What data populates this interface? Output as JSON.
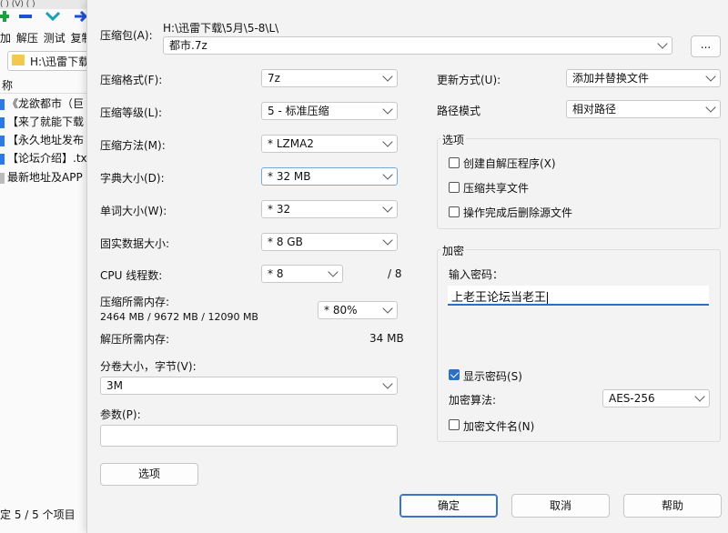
{
  "background_window": {
    "title_fragment": "( )  (V)  ( )",
    "toolbar_labels": [
      "加",
      "解压",
      "测试",
      "复制"
    ],
    "address": "H:\\迅雷下载",
    "column_header": "称",
    "files": [
      "《龙欲都市（巨",
      "【来了就能下载",
      "【永久地址发布",
      "【论坛介绍】.txt",
      "最新地址及APP"
    ],
    "status": "定 5 / 5 个项目"
  },
  "dialog": {
    "archive_label": "压缩包(A):",
    "archive_path": "H:\\迅雷下载\\5月\\5-8\\L\\",
    "archive_name": "都市.7z",
    "browse_label": "...",
    "format_label": "压缩格式(F):",
    "format_value": "7z",
    "level_label": "压缩等级(L):",
    "level_value": "5 - 标准压缩",
    "method_label": "压缩方法(M):",
    "method_value": "* LZMA2",
    "dict_label": "字典大小(D):",
    "dict_value": "* 32 MB",
    "word_label": "单词大小(W):",
    "word_value": "* 32",
    "solid_label": "固实数据大小:",
    "solid_value": "* 8 GB",
    "threads_label": "CPU 线程数:",
    "threads_value": "* 8",
    "threads_max": "/ 8",
    "mem_compress_label": "压缩所需内存:",
    "mem_compress_detail": "2464 MB / 9672 MB / 12090 MB",
    "mem_percent_value": "* 80%",
    "mem_decompress_label": "解压所需内存:",
    "mem_decompress_value": "34 MB",
    "volume_label": "分卷大小，字节(V):",
    "volume_value": "3M",
    "params_label": "参数(P):",
    "params_value": "",
    "options_button": "选项",
    "update_label": "更新方式(U):",
    "update_value": "添加并替换文件",
    "pathmode_label": "路径模式",
    "pathmode_value": "相对路径",
    "options_group_title": "选项",
    "opt_sfx": "创建自解压程序(X)",
    "opt_shared": "压缩共享文件",
    "opt_delete": "操作完成后删除源文件",
    "encrypt_group_title": "加密",
    "password_label": "输入密码：",
    "password_value": "上老王论坛当老王",
    "show_password": "显示密码(S)",
    "show_password_checked": true,
    "enc_method_label": "加密算法:",
    "enc_method_value": "AES-256",
    "enc_filenames": "加密文件名(N)",
    "ok_button": "确定",
    "cancel_button": "取消",
    "help_button": "帮助"
  },
  "colors": {
    "accent": "#2a6fc9",
    "focus_underline": "#2a6fc9",
    "toolbar_green": "#1aa33a",
    "toolbar_blue": "#1f4fd8",
    "toolbar_teal": "#19a0b0"
  }
}
